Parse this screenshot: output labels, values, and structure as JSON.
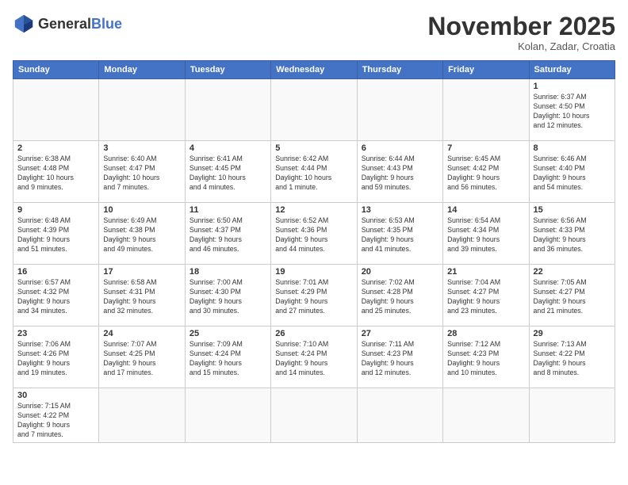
{
  "header": {
    "logo_general": "General",
    "logo_blue": "Blue",
    "month_title": "November 2025",
    "subtitle": "Kolan, Zadar, Croatia"
  },
  "weekdays": [
    "Sunday",
    "Monday",
    "Tuesday",
    "Wednesday",
    "Thursday",
    "Friday",
    "Saturday"
  ],
  "weeks": [
    [
      {
        "day": "",
        "info": ""
      },
      {
        "day": "",
        "info": ""
      },
      {
        "day": "",
        "info": ""
      },
      {
        "day": "",
        "info": ""
      },
      {
        "day": "",
        "info": ""
      },
      {
        "day": "",
        "info": ""
      },
      {
        "day": "1",
        "info": "Sunrise: 6:37 AM\nSunset: 4:50 PM\nDaylight: 10 hours\nand 12 minutes."
      }
    ],
    [
      {
        "day": "2",
        "info": "Sunrise: 6:38 AM\nSunset: 4:48 PM\nDaylight: 10 hours\nand 9 minutes."
      },
      {
        "day": "3",
        "info": "Sunrise: 6:40 AM\nSunset: 4:47 PM\nDaylight: 10 hours\nand 7 minutes."
      },
      {
        "day": "4",
        "info": "Sunrise: 6:41 AM\nSunset: 4:45 PM\nDaylight: 10 hours\nand 4 minutes."
      },
      {
        "day": "5",
        "info": "Sunrise: 6:42 AM\nSunset: 4:44 PM\nDaylight: 10 hours\nand 1 minute."
      },
      {
        "day": "6",
        "info": "Sunrise: 6:44 AM\nSunset: 4:43 PM\nDaylight: 9 hours\nand 59 minutes."
      },
      {
        "day": "7",
        "info": "Sunrise: 6:45 AM\nSunset: 4:42 PM\nDaylight: 9 hours\nand 56 minutes."
      },
      {
        "day": "8",
        "info": "Sunrise: 6:46 AM\nSunset: 4:40 PM\nDaylight: 9 hours\nand 54 minutes."
      }
    ],
    [
      {
        "day": "9",
        "info": "Sunrise: 6:48 AM\nSunset: 4:39 PM\nDaylight: 9 hours\nand 51 minutes."
      },
      {
        "day": "10",
        "info": "Sunrise: 6:49 AM\nSunset: 4:38 PM\nDaylight: 9 hours\nand 49 minutes."
      },
      {
        "day": "11",
        "info": "Sunrise: 6:50 AM\nSunset: 4:37 PM\nDaylight: 9 hours\nand 46 minutes."
      },
      {
        "day": "12",
        "info": "Sunrise: 6:52 AM\nSunset: 4:36 PM\nDaylight: 9 hours\nand 44 minutes."
      },
      {
        "day": "13",
        "info": "Sunrise: 6:53 AM\nSunset: 4:35 PM\nDaylight: 9 hours\nand 41 minutes."
      },
      {
        "day": "14",
        "info": "Sunrise: 6:54 AM\nSunset: 4:34 PM\nDaylight: 9 hours\nand 39 minutes."
      },
      {
        "day": "15",
        "info": "Sunrise: 6:56 AM\nSunset: 4:33 PM\nDaylight: 9 hours\nand 36 minutes."
      }
    ],
    [
      {
        "day": "16",
        "info": "Sunrise: 6:57 AM\nSunset: 4:32 PM\nDaylight: 9 hours\nand 34 minutes."
      },
      {
        "day": "17",
        "info": "Sunrise: 6:58 AM\nSunset: 4:31 PM\nDaylight: 9 hours\nand 32 minutes."
      },
      {
        "day": "18",
        "info": "Sunrise: 7:00 AM\nSunset: 4:30 PM\nDaylight: 9 hours\nand 30 minutes."
      },
      {
        "day": "19",
        "info": "Sunrise: 7:01 AM\nSunset: 4:29 PM\nDaylight: 9 hours\nand 27 minutes."
      },
      {
        "day": "20",
        "info": "Sunrise: 7:02 AM\nSunset: 4:28 PM\nDaylight: 9 hours\nand 25 minutes."
      },
      {
        "day": "21",
        "info": "Sunrise: 7:04 AM\nSunset: 4:27 PM\nDaylight: 9 hours\nand 23 minutes."
      },
      {
        "day": "22",
        "info": "Sunrise: 7:05 AM\nSunset: 4:27 PM\nDaylight: 9 hours\nand 21 minutes."
      }
    ],
    [
      {
        "day": "23",
        "info": "Sunrise: 7:06 AM\nSunset: 4:26 PM\nDaylight: 9 hours\nand 19 minutes."
      },
      {
        "day": "24",
        "info": "Sunrise: 7:07 AM\nSunset: 4:25 PM\nDaylight: 9 hours\nand 17 minutes."
      },
      {
        "day": "25",
        "info": "Sunrise: 7:09 AM\nSunset: 4:24 PM\nDaylight: 9 hours\nand 15 minutes."
      },
      {
        "day": "26",
        "info": "Sunrise: 7:10 AM\nSunset: 4:24 PM\nDaylight: 9 hours\nand 14 minutes."
      },
      {
        "day": "27",
        "info": "Sunrise: 7:11 AM\nSunset: 4:23 PM\nDaylight: 9 hours\nand 12 minutes."
      },
      {
        "day": "28",
        "info": "Sunrise: 7:12 AM\nSunset: 4:23 PM\nDaylight: 9 hours\nand 10 minutes."
      },
      {
        "day": "29",
        "info": "Sunrise: 7:13 AM\nSunset: 4:22 PM\nDaylight: 9 hours\nand 8 minutes."
      }
    ],
    [
      {
        "day": "30",
        "info": "Sunrise: 7:15 AM\nSunset: 4:22 PM\nDaylight: 9 hours\nand 7 minutes."
      },
      {
        "day": "",
        "info": ""
      },
      {
        "day": "",
        "info": ""
      },
      {
        "day": "",
        "info": ""
      },
      {
        "day": "",
        "info": ""
      },
      {
        "day": "",
        "info": ""
      },
      {
        "day": "",
        "info": ""
      }
    ]
  ]
}
